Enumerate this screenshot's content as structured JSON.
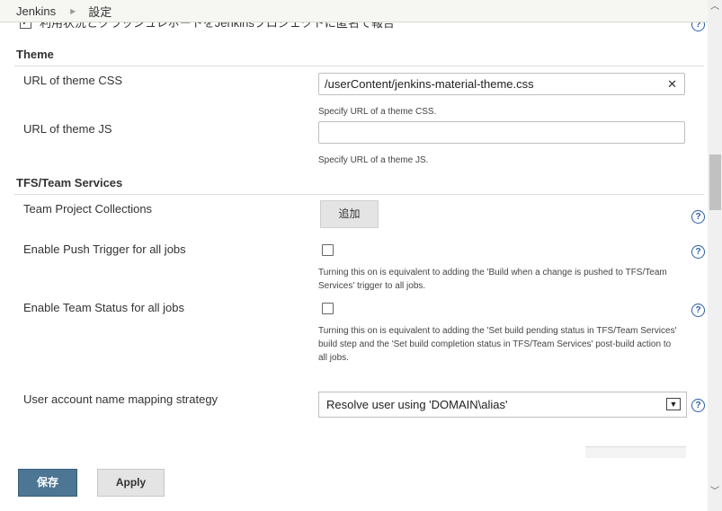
{
  "breadcrumb": {
    "root": "Jenkins",
    "current": "設定"
  },
  "cut_row": {
    "text": "利用状況とクラッシュレポートをJenkinsプロジェクトに匿名で報告"
  },
  "theme": {
    "title": "Theme",
    "css_label": "URL of theme CSS",
    "css_value": "/userContent/jenkins-material-theme.css",
    "css_desc": "Specify URL of a theme CSS.",
    "js_label": "URL of theme JS",
    "js_value": "",
    "js_desc": "Specify URL of a theme JS."
  },
  "tfs": {
    "title": "TFS/Team Services",
    "collections_label": "Team Project Collections",
    "add_button": "追加",
    "push_label": "Enable Push Trigger for all jobs",
    "push_desc": "Turning this on is equivalent to adding the 'Build when a change is pushed to TFS/Team Services' trigger to all jobs.",
    "status_label": "Enable Team Status for all jobs",
    "status_desc": "Turning this on is equivalent to adding the 'Set build pending status in TFS/Team Services' build step and the 'Set build completion status in TFS/Team Services' post-build action to all jobs.",
    "mapping_label": "User account name mapping strategy",
    "mapping_value": "Resolve user using 'DOMAIN\\alias'"
  },
  "buttons": {
    "save": "保存",
    "apply": "Apply"
  },
  "icons": {
    "help": "help-icon",
    "clear": "clear-icon",
    "chevron": "chevron-down-icon",
    "checkmark": "checkbox-checked-icon"
  },
  "colors": {
    "save_button": "#4d7594",
    "help_icon": "#2a5da8"
  }
}
